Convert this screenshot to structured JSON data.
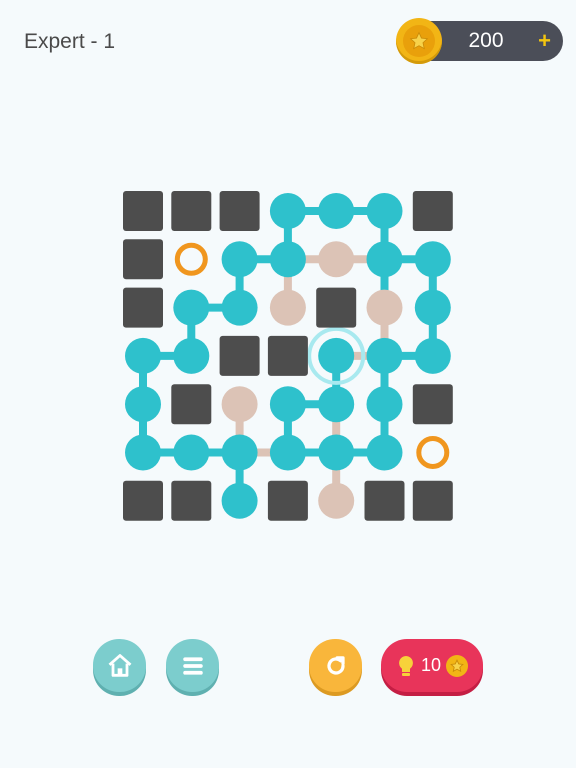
{
  "header": {
    "level_title": "Expert - 1",
    "coins": "200",
    "add_symbol": "+"
  },
  "hint": {
    "count": "10"
  },
  "colors": {
    "wall": "#4d4d4d",
    "active": "#2ec1cc",
    "inactive": "#dcc3b6",
    "ring": "#f0961e",
    "selected_glow": "#a8e9ef"
  },
  "icons": {
    "coin": "star-coin-icon",
    "home": "home-icon",
    "menu": "menu-icon",
    "restart": "restart-icon",
    "hint": "lightbulb-icon"
  },
  "board": {
    "rows": 7,
    "cols": 7,
    "grid": [
      [
        "wall",
        "wall",
        "wall",
        "active",
        "active",
        "active",
        "wall"
      ],
      [
        "wall",
        "ring",
        "active",
        "active",
        "inactive",
        "active",
        "active"
      ],
      [
        "wall",
        "active",
        "active",
        "inactive",
        "wall",
        "inactive",
        "active"
      ],
      [
        "active",
        "active",
        "wall",
        "wall",
        "active",
        "active",
        "active"
      ],
      [
        "active",
        "wall",
        "inactive",
        "active",
        "active",
        "active",
        "wall"
      ],
      [
        "active",
        "active",
        "active",
        "active",
        "active",
        "active",
        "ring"
      ],
      [
        "wall",
        "wall",
        "active",
        "wall",
        "inactive",
        "wall",
        "wall"
      ]
    ],
    "selected": [
      3,
      4
    ],
    "active_links": [
      [
        [
          0,
          3
        ],
        [
          0,
          4
        ]
      ],
      [
        [
          0,
          4
        ],
        [
          0,
          5
        ]
      ],
      [
        [
          0,
          3
        ],
        [
          1,
          3
        ]
      ],
      [
        [
          0,
          5
        ],
        [
          1,
          5
        ]
      ],
      [
        [
          1,
          2
        ],
        [
          1,
          3
        ]
      ],
      [
        [
          1,
          5
        ],
        [
          1,
          6
        ]
      ],
      [
        [
          1,
          5
        ],
        [
          2,
          5
        ]
      ],
      [
        [
          1,
          2
        ],
        [
          2,
          2
        ]
      ],
      [
        [
          1,
          6
        ],
        [
          2,
          6
        ]
      ],
      [
        [
          2,
          1
        ],
        [
          2,
          2
        ]
      ],
      [
        [
          2,
          1
        ],
        [
          3,
          1
        ]
      ],
      [
        [
          2,
          6
        ],
        [
          3,
          6
        ]
      ],
      [
        [
          3,
          0
        ],
        [
          3,
          1
        ]
      ],
      [
        [
          3,
          5
        ],
        [
          3,
          6
        ]
      ],
      [
        [
          3,
          4
        ],
        [
          4,
          4
        ]
      ],
      [
        [
          3,
          5
        ],
        [
          4,
          5
        ]
      ],
      [
        [
          3,
          0
        ],
        [
          4,
          0
        ]
      ],
      [
        [
          4,
          3
        ],
        [
          4,
          4
        ]
      ],
      [
        [
          4,
          0
        ],
        [
          5,
          0
        ]
      ],
      [
        [
          4,
          5
        ],
        [
          5,
          5
        ]
      ],
      [
        [
          4,
          3
        ],
        [
          5,
          3
        ]
      ],
      [
        [
          5,
          0
        ],
        [
          5,
          1
        ]
      ],
      [
        [
          5,
          1
        ],
        [
          5,
          2
        ]
      ],
      [
        [
          5,
          3
        ],
        [
          5,
          4
        ]
      ],
      [
        [
          5,
          4
        ],
        [
          5,
          5
        ]
      ],
      [
        [
          5,
          2
        ],
        [
          6,
          2
        ]
      ]
    ],
    "inactive_links": [
      [
        [
          1,
          3
        ],
        [
          1,
          4
        ]
      ],
      [
        [
          1,
          4
        ],
        [
          1,
          5
        ]
      ],
      [
        [
          1,
          3
        ],
        [
          2,
          3
        ]
      ],
      [
        [
          2,
          5
        ],
        [
          3,
          5
        ]
      ],
      [
        [
          4,
          2
        ],
        [
          5,
          2
        ]
      ],
      [
        [
          5,
          2
        ],
        [
          5,
          3
        ]
      ],
      [
        [
          4,
          4
        ],
        [
          5,
          4
        ]
      ],
      [
        [
          5,
          4
        ],
        [
          6,
          4
        ]
      ],
      [
        [
          3,
          4
        ],
        [
          3,
          5
        ]
      ]
    ]
  }
}
